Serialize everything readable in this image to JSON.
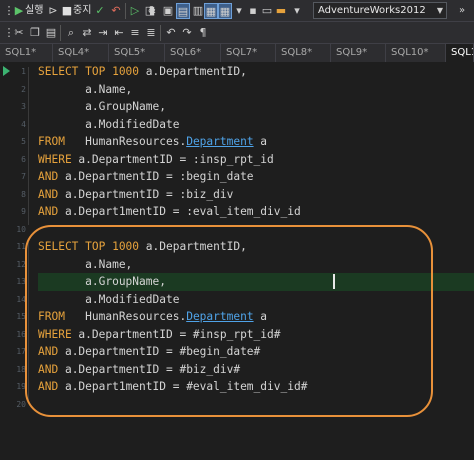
{
  "toolbar": {
    "run_label": "실행",
    "stop_label": "중지",
    "amp": "&",
    "database": "AdventureWorks2012"
  },
  "tabs": [
    {
      "label": "SQL1*",
      "active": false
    },
    {
      "label": "SQL4*",
      "active": false
    },
    {
      "label": "SQL5*",
      "active": false
    },
    {
      "label": "SQL6*",
      "active": false
    },
    {
      "label": "SQL7*",
      "active": false
    },
    {
      "label": "SQL8*",
      "active": false
    },
    {
      "label": "SQL9*",
      "active": false
    },
    {
      "label": "SQL10*",
      "active": false
    },
    {
      "label": "SQL1",
      "active": true
    }
  ],
  "editor": {
    "line_numbers": [
      "1",
      "2",
      "3",
      "4",
      "5",
      "6",
      "7",
      "8",
      "9",
      "10",
      "11",
      "12",
      "13",
      "14",
      "15",
      "16",
      "17",
      "18",
      "19",
      "20"
    ],
    "current_line": 13,
    "lines": [
      [
        {
          "t": "SELECT TOP 1000 ",
          "k": "kw"
        },
        {
          "t": "a.DepartmentID,"
        }
      ],
      [
        {
          "t": "       a.Name,"
        }
      ],
      [
        {
          "t": "       a.GroupName,"
        }
      ],
      [
        {
          "t": "       a.ModifiedDate"
        }
      ],
      [
        {
          "t": "FROM   ",
          "k": "kw"
        },
        {
          "t": "HumanResources."
        },
        {
          "t": "Department",
          "k": "tbl"
        },
        {
          "t": " a"
        }
      ],
      [
        {
          "t": "WHERE ",
          "k": "kw"
        },
        {
          "t": "a.DepartmentID = :insp_rpt_id"
        }
      ],
      [
        {
          "t": "AND ",
          "k": "kw"
        },
        {
          "t": "a.DepartmentID = :begin_date"
        }
      ],
      [
        {
          "t": "AND ",
          "k": "kw"
        },
        {
          "t": "a.DepartmentID = :biz_div"
        }
      ],
      [
        {
          "t": "AND ",
          "k": "kw"
        },
        {
          "t": "a.Depart1mentID = :eval_item_div_id"
        }
      ],
      [],
      [
        {
          "t": "SELECT TOP 1000 ",
          "k": "kw"
        },
        {
          "t": "a.DepartmentID,"
        }
      ],
      [
        {
          "t": "       a.Name,"
        }
      ],
      [
        {
          "t": "       a.GroupName,"
        }
      ],
      [
        {
          "t": "       a.ModifiedDate"
        }
      ],
      [
        {
          "t": "FROM   ",
          "k": "kw"
        },
        {
          "t": "HumanResources."
        },
        {
          "t": "Department",
          "k": "tbl"
        },
        {
          "t": " a"
        }
      ],
      [
        {
          "t": "WHERE ",
          "k": "kw"
        },
        {
          "t": "a.DepartmentID = #insp_rpt_id#"
        }
      ],
      [
        {
          "t": "AND ",
          "k": "kw"
        },
        {
          "t": "a.DepartmentID = #begin_date#"
        }
      ],
      [
        {
          "t": "AND ",
          "k": "kw"
        },
        {
          "t": "a.DepartmentID = #biz_div#"
        }
      ],
      [
        {
          "t": "AND ",
          "k": "kw"
        },
        {
          "t": "a.Depart1mentID = #eval_item_div_id#"
        }
      ],
      []
    ]
  }
}
